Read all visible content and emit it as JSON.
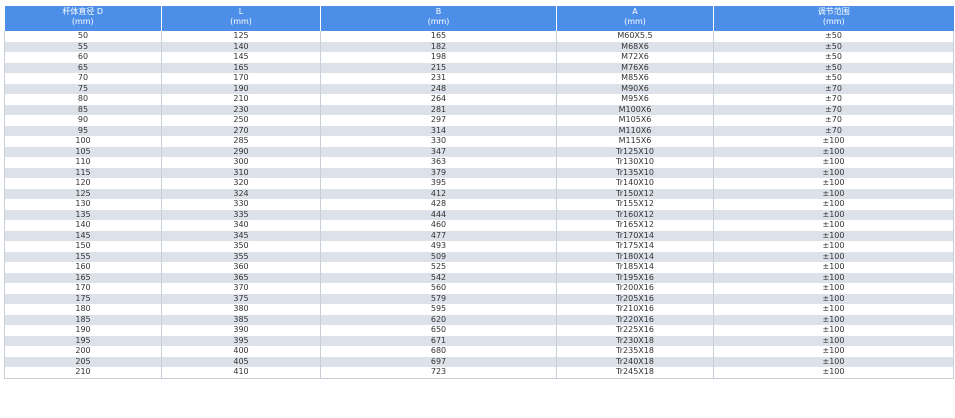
{
  "table": {
    "headers": [
      {
        "label": "杆体直径 D",
        "unit": "(mm)"
      },
      {
        "label": "L",
        "unit": "(mm)"
      },
      {
        "label": "B",
        "unit": "(mm)"
      },
      {
        "label": "A",
        "unit": "(mm)"
      },
      {
        "label": "调节范围",
        "unit": "(mm)"
      }
    ],
    "rows": [
      [
        "50",
        "125",
        "165",
        "M60X5.5",
        "±50"
      ],
      [
        "55",
        "140",
        "182",
        "M68X6",
        "±50"
      ],
      [
        "60",
        "145",
        "198",
        "M72X6",
        "±50"
      ],
      [
        "65",
        "165",
        "215",
        "M76X6",
        "±50"
      ],
      [
        "70",
        "170",
        "231",
        "M85X6",
        "±50"
      ],
      [
        "75",
        "190",
        "248",
        "M90X6",
        "±70"
      ],
      [
        "80",
        "210",
        "264",
        "M95X6",
        "±70"
      ],
      [
        "85",
        "230",
        "281",
        "M100X6",
        "±70"
      ],
      [
        "90",
        "250",
        "297",
        "M105X6",
        "±70"
      ],
      [
        "95",
        "270",
        "314",
        "M110X6",
        "±70"
      ],
      [
        "100",
        "285",
        "330",
        "M115X6",
        "±100"
      ],
      [
        "105",
        "290",
        "347",
        "Tr125X10",
        "±100"
      ],
      [
        "110",
        "300",
        "363",
        "Tr130X10",
        "±100"
      ],
      [
        "115",
        "310",
        "379",
        "Tr135X10",
        "±100"
      ],
      [
        "120",
        "320",
        "395",
        "Tr140X10",
        "±100"
      ],
      [
        "125",
        "324",
        "412",
        "Tr150X12",
        "±100"
      ],
      [
        "130",
        "330",
        "428",
        "Tr155X12",
        "±100"
      ],
      [
        "135",
        "335",
        "444",
        "Tr160X12",
        "±100"
      ],
      [
        "140",
        "340",
        "460",
        "Tr165X12",
        "±100"
      ],
      [
        "145",
        "345",
        "477",
        "Tr170X14",
        "±100"
      ],
      [
        "150",
        "350",
        "493",
        "Tr175X14",
        "±100"
      ],
      [
        "155",
        "355",
        "509",
        "Tr180X14",
        "±100"
      ],
      [
        "160",
        "360",
        "525",
        "Tr185X14",
        "±100"
      ],
      [
        "165",
        "365",
        "542",
        "Tr195X16",
        "±100"
      ],
      [
        "170",
        "370",
        "560",
        "Tr200X16",
        "±100"
      ],
      [
        "175",
        "375",
        "579",
        "Tr205X16",
        "±100"
      ],
      [
        "180",
        "380",
        "595",
        "Tr210X16",
        "±100"
      ],
      [
        "185",
        "385",
        "620",
        "Tr220X16",
        "±100"
      ],
      [
        "190",
        "390",
        "650",
        "Tr225X16",
        "±100"
      ],
      [
        "195",
        "395",
        "671",
        "Tr230X18",
        "±100"
      ],
      [
        "200",
        "400",
        "680",
        "Tr235X18",
        "±100"
      ],
      [
        "205",
        "405",
        "697",
        "Tr240X18",
        "±100"
      ],
      [
        "210",
        "410",
        "723",
        "Tr245X18",
        "±100"
      ]
    ]
  },
  "colors": {
    "header_bg": "#4d8fe8",
    "header_text": "#ffffff",
    "row_alt_bg": "#dde2ea",
    "row_bg": "#ffffff",
    "text": "#333333"
  }
}
